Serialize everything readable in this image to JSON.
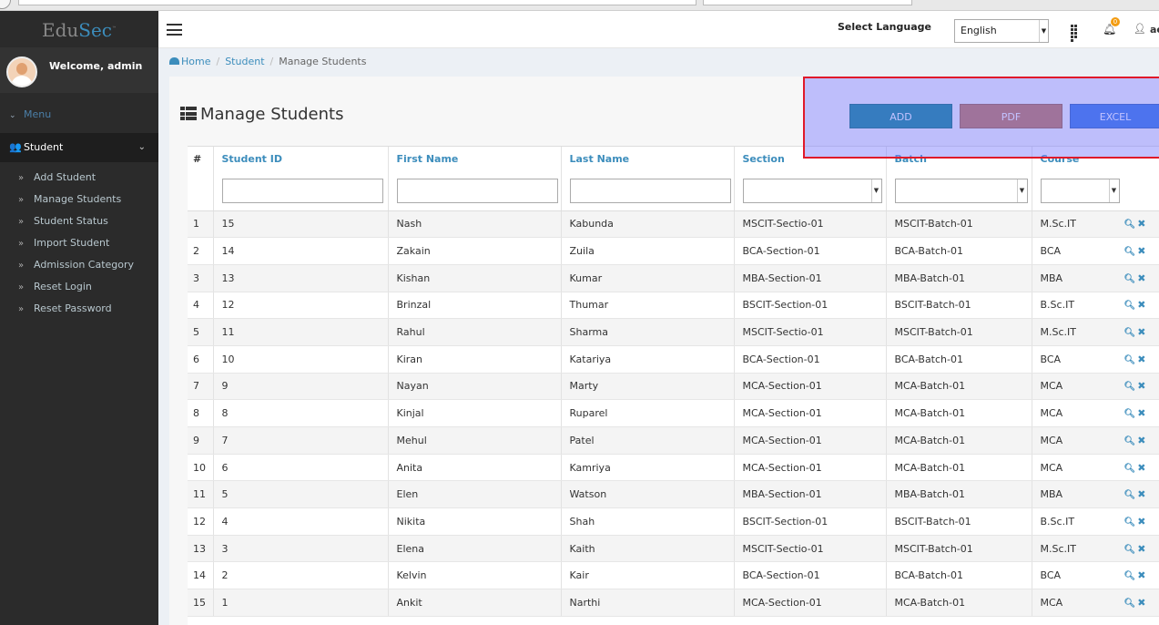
{
  "brand": {
    "edu": "Edu",
    "sec": "Sec",
    "tm": "™"
  },
  "user_panel": {
    "welcome": "Welcome, admin"
  },
  "sidebar": {
    "menu_label": "Menu",
    "student_label": "Student",
    "items": [
      {
        "label": "Add Student"
      },
      {
        "label": "Manage Students"
      },
      {
        "label": "Student Status"
      },
      {
        "label": "Import Student"
      },
      {
        "label": "Admission Category"
      },
      {
        "label": "Reset Login"
      },
      {
        "label": "Reset Password"
      }
    ]
  },
  "header": {
    "select_language": "Select Language",
    "language_value": "English",
    "notification_count": "0",
    "user_short": "ac"
  },
  "breadcrumb": {
    "home": "Home",
    "student": "Student",
    "current": "Manage Students"
  },
  "page": {
    "title": "Manage Students",
    "buttons": {
      "add": "ADD",
      "pdf": "PDF",
      "excel": "EXCEL"
    }
  },
  "table": {
    "headers": {
      "hash": "#",
      "student_id": "Student ID",
      "first_name": "First Name",
      "last_name": "Last Name",
      "section": "Section",
      "batch": "Batch",
      "course": "Course"
    },
    "rows": [
      {
        "n": "1",
        "id": "15",
        "first": "Nash",
        "last": "Kabunda",
        "section": "MSCIT-Sectio-01",
        "batch": "MSCIT-Batch-01",
        "course": "M.Sc.IT"
      },
      {
        "n": "2",
        "id": "14",
        "first": "Zakain",
        "last": "Zuila",
        "section": "BCA-Section-01",
        "batch": "BCA-Batch-01",
        "course": "BCA"
      },
      {
        "n": "3",
        "id": "13",
        "first": "Kishan",
        "last": "Kumar",
        "section": "MBA-Section-01",
        "batch": "MBA-Batch-01",
        "course": "MBA"
      },
      {
        "n": "4",
        "id": "12",
        "first": "Brinzal",
        "last": "Thumar",
        "section": "BSCIT-Section-01",
        "batch": "BSCIT-Batch-01",
        "course": "B.Sc.IT"
      },
      {
        "n": "5",
        "id": "11",
        "first": "Rahul",
        "last": "Sharma",
        "section": "MSCIT-Sectio-01",
        "batch": "MSCIT-Batch-01",
        "course": "M.Sc.IT"
      },
      {
        "n": "6",
        "id": "10",
        "first": "Kiran",
        "last": "Katariya",
        "section": "BCA-Section-01",
        "batch": "BCA-Batch-01",
        "course": "BCA"
      },
      {
        "n": "7",
        "id": "9",
        "first": "Nayan",
        "last": "Marty",
        "section": "MCA-Section-01",
        "batch": "MCA-Batch-01",
        "course": "MCA"
      },
      {
        "n": "8",
        "id": "8",
        "first": "Kinjal",
        "last": "Ruparel",
        "section": "MCA-Section-01",
        "batch": "MCA-Batch-01",
        "course": "MCA"
      },
      {
        "n": "9",
        "id": "7",
        "first": "Mehul",
        "last": "Patel",
        "section": "MCA-Section-01",
        "batch": "MCA-Batch-01",
        "course": "MCA"
      },
      {
        "n": "10",
        "id": "6",
        "first": "Anita",
        "last": "Kamriya",
        "section": "MCA-Section-01",
        "batch": "MCA-Batch-01",
        "course": "MCA"
      },
      {
        "n": "11",
        "id": "5",
        "first": "Elen",
        "last": "Watson",
        "section": "MBA-Section-01",
        "batch": "MBA-Batch-01",
        "course": "MBA"
      },
      {
        "n": "12",
        "id": "4",
        "first": "Nikita",
        "last": "Shah",
        "section": "BSCIT-Section-01",
        "batch": "BSCIT-Batch-01",
        "course": "B.Sc.IT"
      },
      {
        "n": "13",
        "id": "3",
        "first": "Elena",
        "last": "Kaith",
        "section": "MSCIT-Sectio-01",
        "batch": "MSCIT-Batch-01",
        "course": "M.Sc.IT"
      },
      {
        "n": "14",
        "id": "2",
        "first": "Kelvin",
        "last": "Kair",
        "section": "BCA-Section-01",
        "batch": "BCA-Batch-01",
        "course": "BCA"
      },
      {
        "n": "15",
        "id": "1",
        "first": "Ankit",
        "last": "Narthi",
        "section": "MCA-Section-01",
        "batch": "MCA-Batch-01",
        "course": "MCA"
      }
    ]
  },
  "colors": {
    "accent": "#3c8dbc",
    "add": "#00808a",
    "pdf": "#c0704a",
    "excel": "#2a6fe0",
    "highlight_border": "#e0192a"
  },
  "icons": {
    "view": "search-icon",
    "delete": "close-icon"
  }
}
